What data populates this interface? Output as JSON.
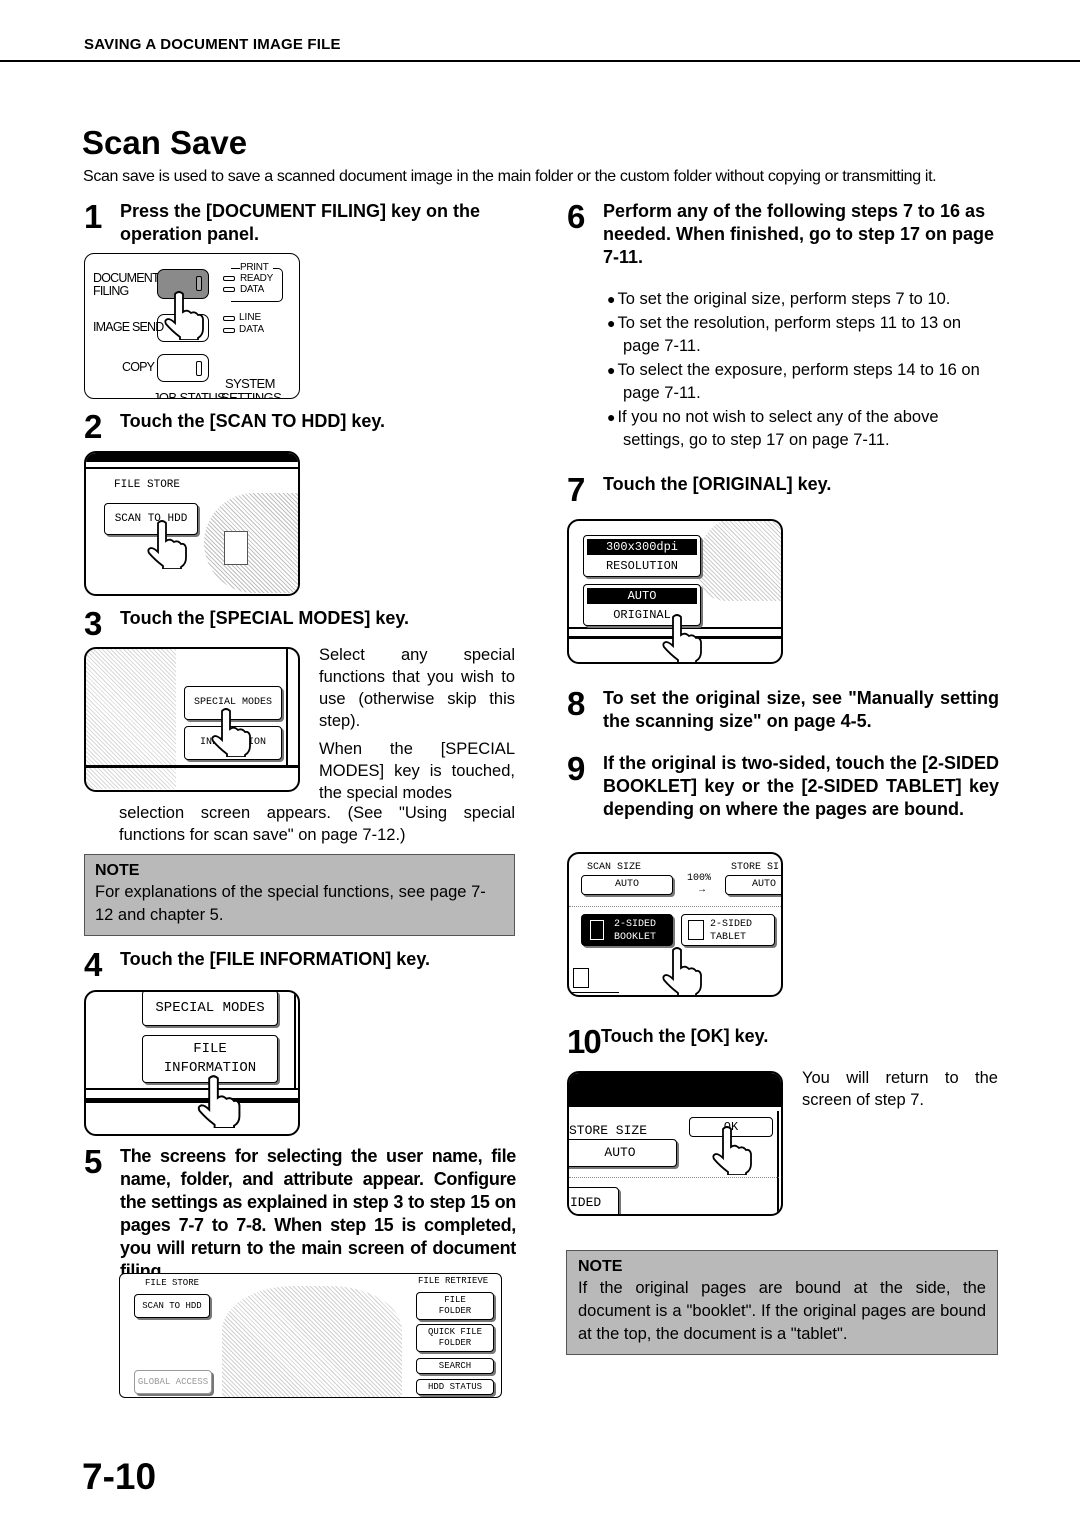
{
  "running_head": "SAVING A DOCUMENT IMAGE FILE",
  "title": "Scan Save",
  "intro": "Scan save is used to save a scanned document image in the main folder or the custom folder without copying or transmitting it.",
  "steps": [
    {
      "num": "1",
      "text": "Press the [DOCUMENT FILING] key on the operation panel."
    },
    {
      "num": "2",
      "text": "Touch the [SCAN TO HDD] key."
    },
    {
      "num": "3",
      "text": "Touch the [SPECIAL MODES] key.",
      "body_side": "Select any special functions that you wish to use (otherwise skip this step).",
      "body_side2": "When the [SPECIAL MODES] key is touched, the special modes",
      "body_below": "selection screen appears. (See \"Using special functions for scan save\" on page 7-12.)"
    },
    {
      "num": "4",
      "text": "Touch the [FILE INFORMATION] key."
    },
    {
      "num": "5",
      "text": "The screens for selecting the user name, file name, folder, and attribute appear. Configure the settings as explained in step 3 to step 15 on pages 7-7 to 7-8. When step 15 is completed, you will return to the main screen of document filing."
    },
    {
      "num": "6",
      "text": "Perform any of the following steps 7 to 16 as needed. When finished, go to step 17 on page 7-11.",
      "bullets": [
        "To set the original size, perform steps 7 to 10.",
        "To set the resolution, perform steps 11 to 13 on page 7-11.",
        "To select the exposure, perform steps 14 to 16 on page 7-11.",
        "If you no not wish to select any of the above settings, go to step 17 on page 7-11."
      ]
    },
    {
      "num": "7",
      "text": "Touch the [ORIGINAL] key."
    },
    {
      "num": "8",
      "text": "To set the original size, see \"Manually setting the scanning size\" on page 4-5."
    },
    {
      "num": "9",
      "text": "If the original is two-sided, touch the [2-SIDED BOOKLET] key or the [2-SIDED TABLET] key depending on where the pages are bound."
    },
    {
      "num": "10",
      "text": "Touch the [OK] key.",
      "body_side": "You will return to the screen of step 7."
    }
  ],
  "notes": [
    {
      "title": "NOTE",
      "body": "For explanations of the special functions, see page 7-12 and chapter 5."
    },
    {
      "title": "NOTE",
      "body": "If the original pages are bound at the side, the document is a \"booklet\". If the original pages are bound at the top, the document is a \"tablet\"."
    }
  ],
  "fig1": {
    "document": "DOCUMENT",
    "filing": "FILING",
    "image_send": "IMAGE SEND",
    "copy": "COPY",
    "print": "PRINT",
    "ready": "READY",
    "data": "DATA",
    "line": "LINE",
    "data2": "DATA",
    "system": "SYSTEM",
    "cut_left": "JOB STATUS",
    "cut_right": "SETTINGS"
  },
  "fig2": {
    "label": "FILE STORE",
    "key": "SCAN TO HDD"
  },
  "fig3": {
    "key1": "SPECIAL MODES",
    "key2": "INFORMATION"
  },
  "fig4": {
    "key1": "SPECIAL MODES",
    "key2_line1": "FILE",
    "key2_line2": "INFORMATION"
  },
  "fig5": {
    "file_store": "FILE STORE",
    "scan_to_hdd": "SCAN TO HDD",
    "global_access": "GLOBAL ACCESS",
    "file_retrieve": "FILE RETRIEVE",
    "file_folder_1": "FILE",
    "file_folder_2": "FOLDER",
    "quick_1": "QUICK FILE",
    "quick_2": "FOLDER",
    "search": "SEARCH",
    "hdd_status": "HDD STATUS"
  },
  "fig7": {
    "resolution_value": "300x300dpi",
    "resolution_label": "RESOLUTION",
    "original_value": "AUTO",
    "original_label": "ORIGINAL"
  },
  "fig9": {
    "scan_size": "SCAN SIZE",
    "scan_val": "AUTO",
    "ratio": "100%",
    "arrow": "→",
    "store_size": "STORE SI",
    "store_val": "AUTO",
    "booklet_1": "2-SIDED",
    "booklet_2": "BOOKLET",
    "tablet_1": "2-SIDED",
    "tablet_2": "TABLET"
  },
  "fig10": {
    "store_size": "STORE SIZE",
    "store_val": "AUTO",
    "ok": "OK",
    "sided": "IDED"
  },
  "page_number": "7-10"
}
